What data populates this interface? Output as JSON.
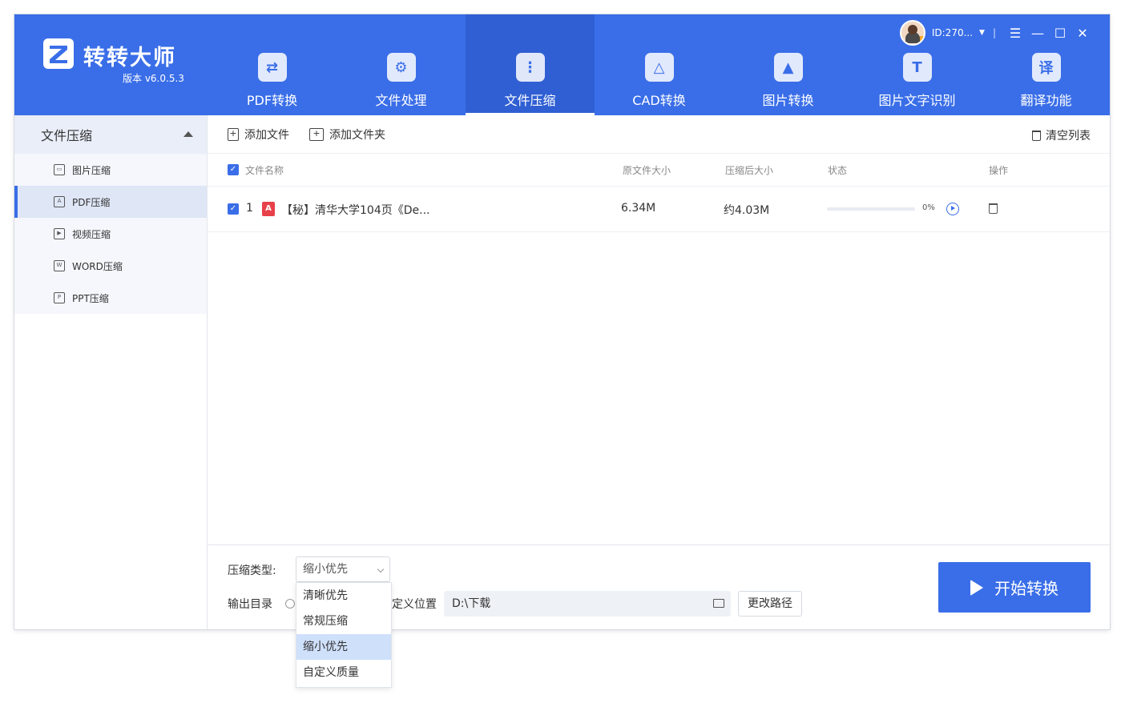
{
  "app": {
    "name": "转转大师",
    "version": "版本 v6.0.5.3",
    "user_id": "ID:270..."
  },
  "tabs": [
    {
      "label": "PDF转换",
      "icon": "pdf-convert-icon"
    },
    {
      "label": "文件处理",
      "icon": "file-process-icon"
    },
    {
      "label": "文件压缩",
      "icon": "zip-icon"
    },
    {
      "label": "CAD转换",
      "icon": "cad-icon"
    },
    {
      "label": "图片转换",
      "icon": "image-icon"
    },
    {
      "label": "图片文字识别",
      "icon": "ocr-icon",
      "glyph": "T"
    },
    {
      "label": "翻译功能",
      "icon": "translate-icon",
      "glyph": "译"
    }
  ],
  "sidebar": {
    "header": "文件压缩",
    "items": [
      {
        "label": "图片压缩"
      },
      {
        "label": "PDF压缩"
      },
      {
        "label": "视频压缩"
      },
      {
        "label": "WORD压缩"
      },
      {
        "label": "PPT压缩"
      }
    ]
  },
  "toolbar": {
    "add_file": "添加文件",
    "add_folder": "添加文件夹",
    "clear_list": "清空列表"
  },
  "table": {
    "headers": {
      "name": "文件名称",
      "original_size": "原文件大小",
      "compressed_size": "压缩后大小",
      "status": "状态",
      "action": "操作"
    },
    "rows": [
      {
        "index": "1",
        "name": "【秘】清华大学104页《De...",
        "original_size": "6.34M",
        "compressed_size": "约4.03M",
        "progress_text": "0%",
        "progress": 0
      }
    ]
  },
  "bottom": {
    "compress_type_label": "压缩类型:",
    "compress_type_value": "缩小优先",
    "output_label": "输出目录",
    "custom_location_label": "定义位置",
    "path": "D:\\下载",
    "change_path": "更改路径",
    "start": "开始转换"
  },
  "dropdown_options": [
    "清晰优先",
    "常规压缩",
    "缩小优先",
    "自定义质量"
  ],
  "colors": {
    "primary": "#3a6ee8",
    "header_active": "#2f5fd3",
    "pdf_red": "#e8414a"
  }
}
